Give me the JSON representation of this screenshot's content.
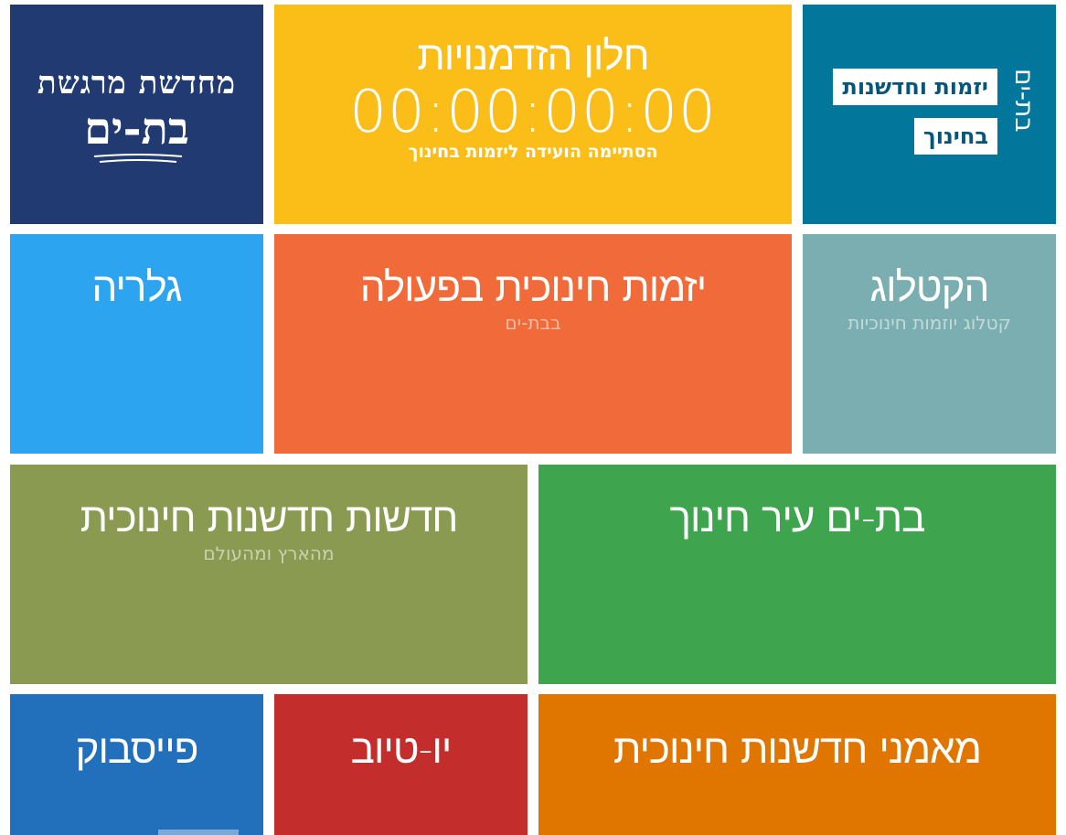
{
  "tiles": {
    "logo_festival": {
      "line1": "מחדשת מרגשת",
      "line2": "בת-ים"
    },
    "timer": {
      "title": "חלון הזדמנויות",
      "value": "00:00:00:00",
      "caption": "הסתיימה הועידה ליזמות בחינוך"
    },
    "logo_education": {
      "vertical": "בת-ים",
      "box1": "יזמות וחדשנות",
      "box2": "בחינוך"
    },
    "gallery": {
      "title": "גלריה"
    },
    "initiatives": {
      "title": "יזמות חינוכית בפעולה",
      "subtitle": "בבת-ים"
    },
    "catalog": {
      "title": "הקטלוג",
      "subtitle": "קטלוג יוזמות חינוכיות"
    },
    "news": {
      "title": "חדשות חדשנות חינוכית",
      "subtitle": "מהארץ ומהעולם"
    },
    "city": {
      "title": "בת-ים עיר חינוך"
    },
    "facebook": {
      "title": "פייסבוק"
    },
    "youtube": {
      "title": "יו-טיוב"
    },
    "mentors": {
      "title": "מאמני חדשנות חינוכית"
    }
  },
  "colors": {
    "navy": "#213b72",
    "yellow": "#fbbd18",
    "teal": "#02779b",
    "sky": "#2da4f0",
    "orange_red": "#f16b3a",
    "grey_teal": "#7aaeb0",
    "olive": "#8a9a50",
    "green": "#3ea54e",
    "blue": "#2270bb",
    "red": "#c32d2c",
    "orange": "#e07600"
  }
}
